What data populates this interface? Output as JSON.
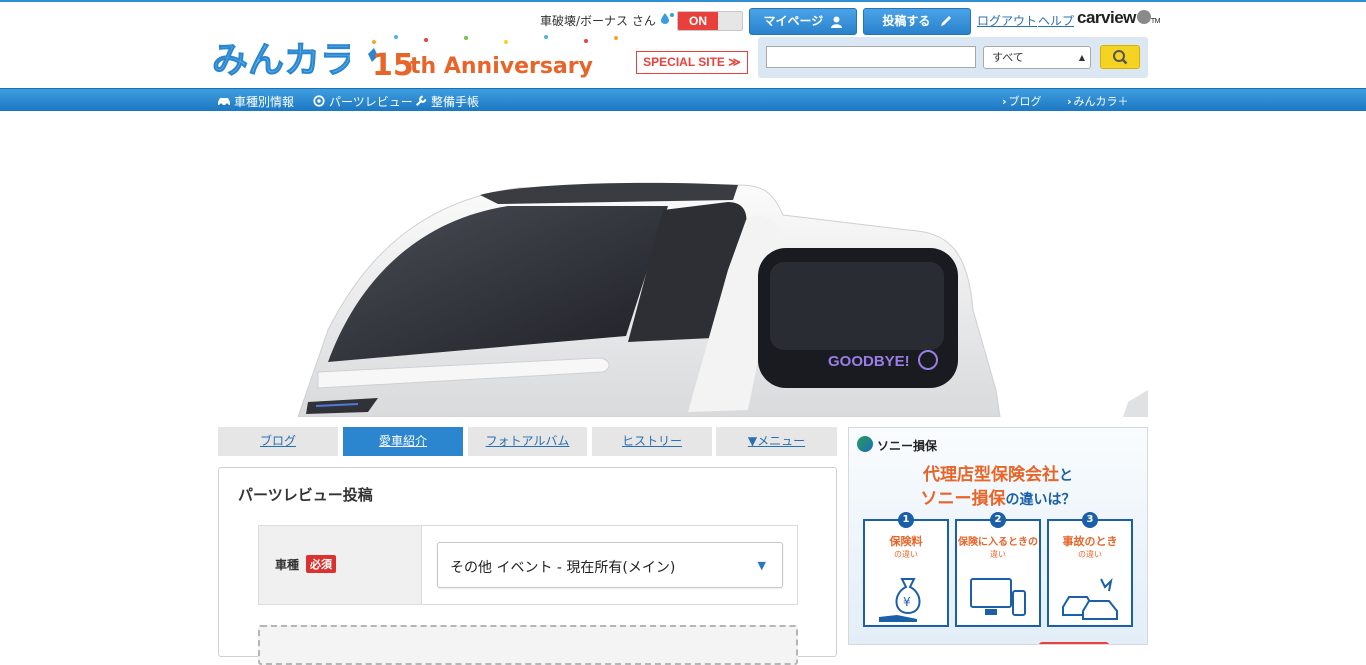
{
  "header": {
    "user_name": "車破壊/ボーナス さん",
    "toggle_state": "ON",
    "mypage_label": "マイページ",
    "post_label": "投稿する",
    "logout_label": "ログアウト",
    "help_label": "ヘルプ",
    "carview_brand": "carview",
    "logo_text": "みんカラ",
    "anniversary_num": "15",
    "anniversary_suffix": "th Anniversary",
    "special_site_label": "SPECIAL SITE ≫"
  },
  "search": {
    "placeholder": "",
    "select_value": "すべて"
  },
  "nav": {
    "left": [
      {
        "label": "車種別情報",
        "icon": "car-icon"
      },
      {
        "label": "パーツレビュー",
        "icon": "gear-icon"
      },
      {
        "label": "整備手帳",
        "icon": "wrench-icon"
      }
    ],
    "right": [
      {
        "label": "ブログ"
      },
      {
        "label": "みんカラ＋"
      }
    ]
  },
  "hero": {
    "rear_window_text": "GOODBYE!"
  },
  "tabs": [
    {
      "label": "ブログ",
      "active": false
    },
    {
      "label": "愛車紹介",
      "active": true
    },
    {
      "label": "フォトアルバム",
      "active": false
    },
    {
      "label": "ヒストリー",
      "active": false
    },
    {
      "label": "▼メニュー",
      "active": false
    }
  ],
  "form": {
    "title": "パーツレビュー投稿",
    "car_label": "車種",
    "required_badge": "必須",
    "car_value": "その他 イベント - 現在所有(メイン)"
  },
  "ad": {
    "brand": "ソニー損保",
    "headline_line1": "代理店型保険会社",
    "headline_line1_suffix": "と",
    "headline_line2": "ソニー損保",
    "headline_line2_suffix": "の違いは？",
    "cards": [
      {
        "num": "1",
        "title": "保険料",
        "sub": "の違い"
      },
      {
        "num": "2",
        "title": "保険に入るときの",
        "sub": "違い"
      },
      {
        "num": "3",
        "title": "事故のとき",
        "sub": "の違い"
      }
    ]
  },
  "colors": {
    "accent": "#2b86cf",
    "nav": "#1c77c2",
    "alert": "#e8413c",
    "search_button": "#f5d323"
  }
}
